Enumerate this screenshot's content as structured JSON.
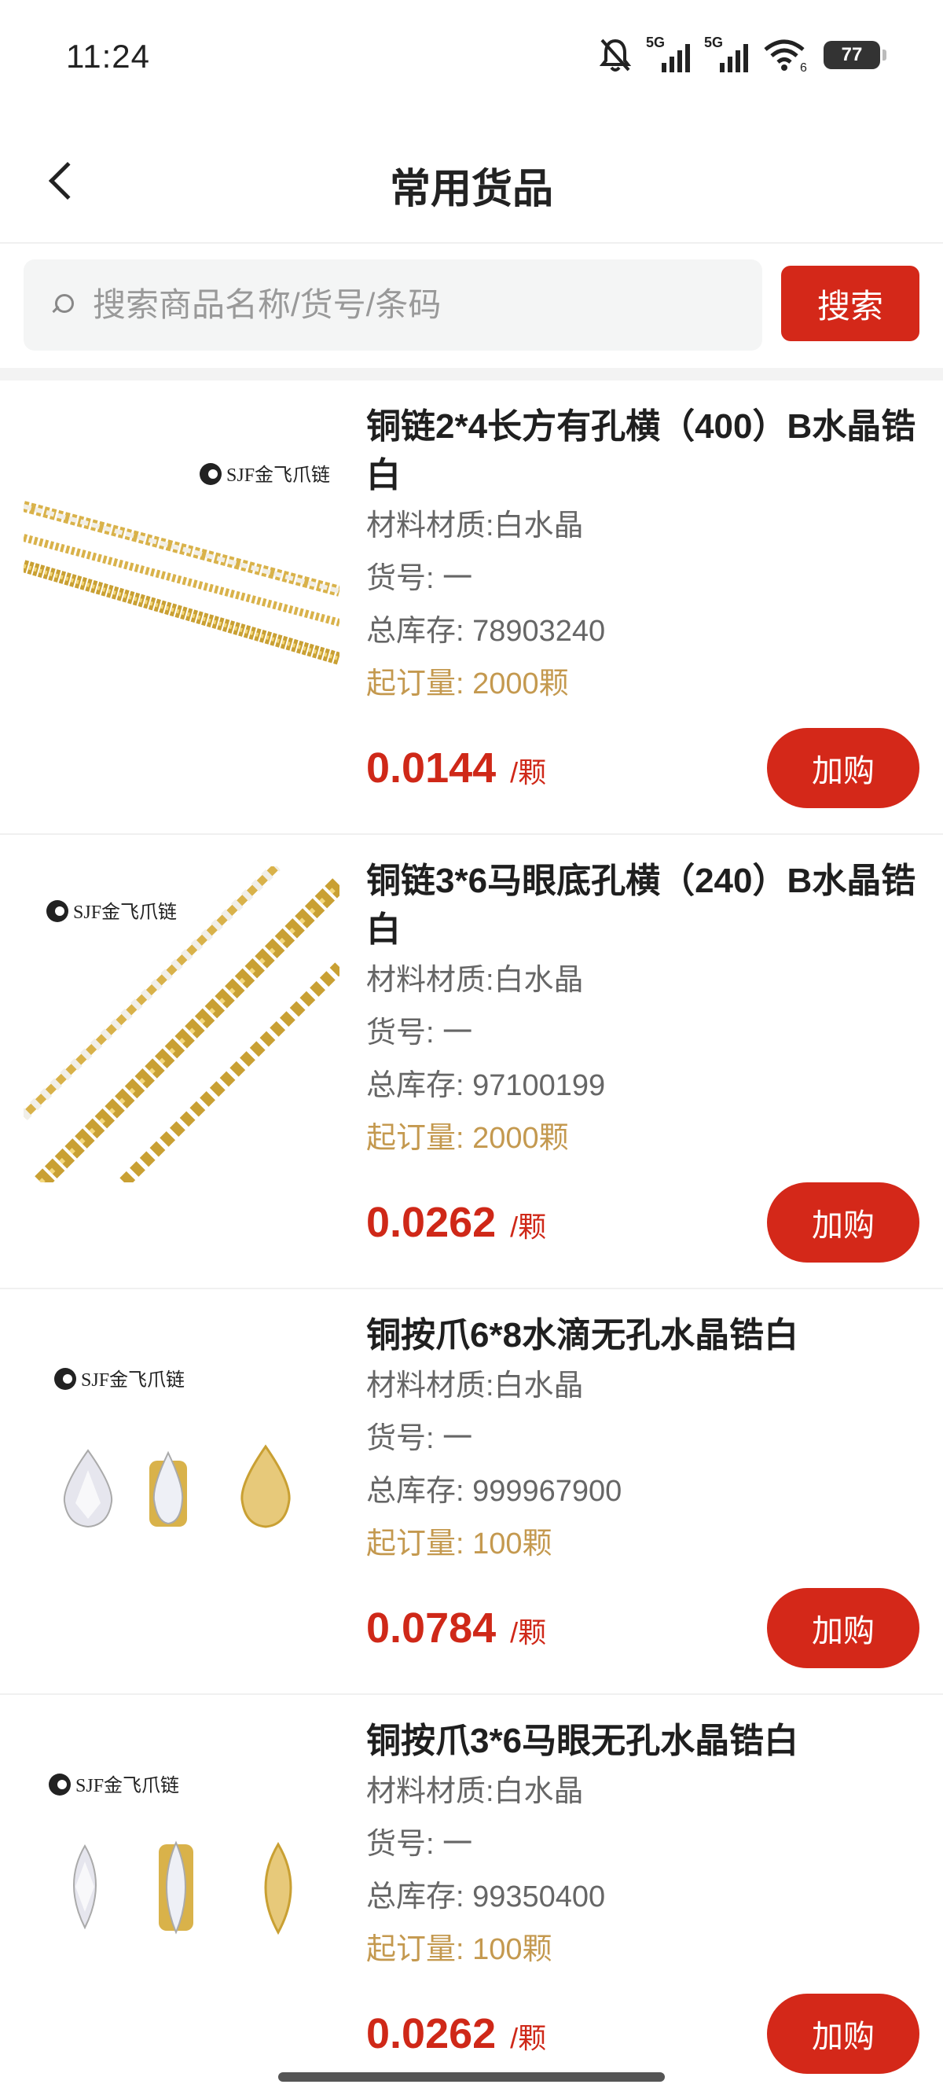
{
  "status_bar": {
    "time": "11:24",
    "sim1": "5G",
    "sim2": "5G",
    "wifi_badge": "6",
    "battery": "77"
  },
  "header": {
    "title": "常用货品"
  },
  "search": {
    "placeholder": "搜索商品名称/货号/条码",
    "button_label": "搜索"
  },
  "brand_logo_text": "SJF金飞爪链",
  "products": [
    {
      "name": "铜链2*4长方有孔横（400）B水晶锆白",
      "material": "材料材质:白水晶",
      "sku": "货号: 一",
      "stock": "总库存: 78903240",
      "moq": "起订量: 2000颗",
      "price": "0.0144",
      "unit": "/颗",
      "button": "加购"
    },
    {
      "name": "铜链3*6马眼底孔横（240）B水晶锆白",
      "material": "材料材质:白水晶",
      "sku": "货号: 一",
      "stock": "总库存: 97100199",
      "moq": "起订量: 2000颗",
      "price": "0.0262",
      "unit": "/颗",
      "button": "加购"
    },
    {
      "name": "铜按爪6*8水滴无孔水晶锆白",
      "material": "材料材质:白水晶",
      "sku": "货号: 一",
      "stock": "总库存: 999967900",
      "moq": "起订量: 100颗",
      "price": "0.0784",
      "unit": "/颗",
      "button": "加购"
    },
    {
      "name": "铜按爪3*6马眼无孔水晶锆白",
      "material": "材料材质:白水晶",
      "sku": "货号: 一",
      "stock": "总库存: 99350400",
      "moq": "起订量: 100颗",
      "price": "0.0262",
      "unit": "/颗",
      "button": "加购"
    }
  ],
  "colors": {
    "accent": "#d42819",
    "price": "#cf2818",
    "moq": "#c4994f",
    "gold": "#d9b24a"
  }
}
